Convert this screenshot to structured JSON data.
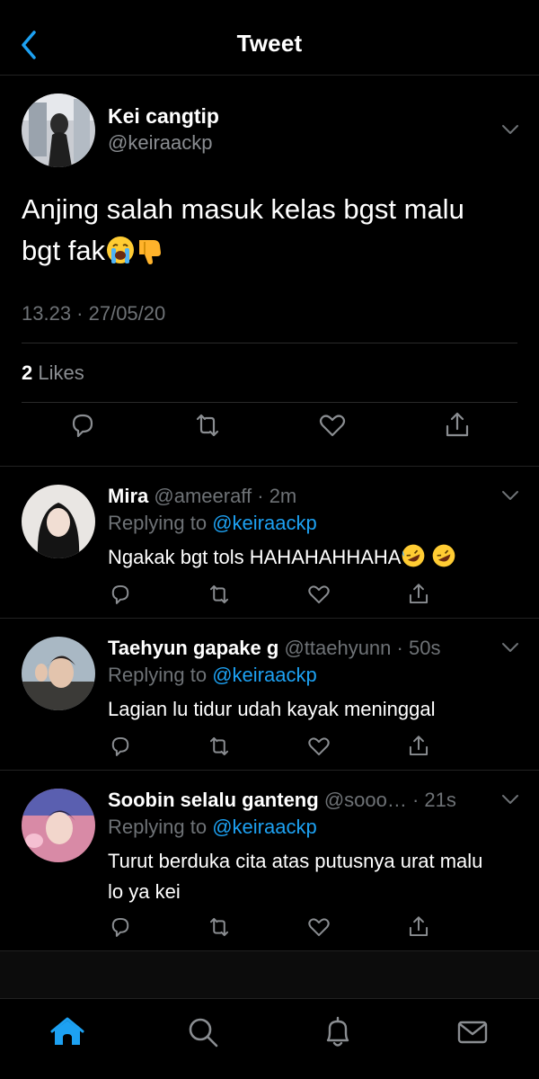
{
  "header": {
    "title": "Tweet",
    "back_icon": "chevron-left-icon"
  },
  "colors": {
    "accent": "#1da1f2",
    "background": "#000000",
    "muted": "#6e7276"
  },
  "main_tweet": {
    "name": "Kei cangtip",
    "handle": "@keiraackp",
    "text": "Anjing salah masuk kelas bgst malu bgt fak",
    "emojis": [
      "loudly-crying-face",
      "thumbs-down"
    ],
    "timestamp": "13.23 · 27/05/20",
    "likes_count": "2",
    "likes_label": " Likes"
  },
  "replies": [
    {
      "name": "Mira",
      "handle": "@ameeraff",
      "time": " · 2m",
      "replying_prefix": "Replying to ",
      "replying_to": "@keiraackp",
      "text": "Ngakak bgt tols HAHAHAHHAHA"
    },
    {
      "name": "Taehyun gapake g",
      "handle": "@ttaehyunn",
      "time": " · 50s",
      "replying_prefix": "Replying to ",
      "replying_to": "@keiraackp",
      "text": "Lagian lu tidur udah kayak meninggal"
    },
    {
      "name": "Soobin selalu ganteng",
      "handle": "@sooo…",
      "time": " · 21s",
      "replying_prefix": "Replying to ",
      "replying_to": "@keiraackp",
      "text": "Turut berduka cita atas putusnya urat malu lo ya kei"
    }
  ],
  "tabs": [
    "home-icon",
    "search-icon",
    "notifications-icon",
    "messages-icon"
  ]
}
